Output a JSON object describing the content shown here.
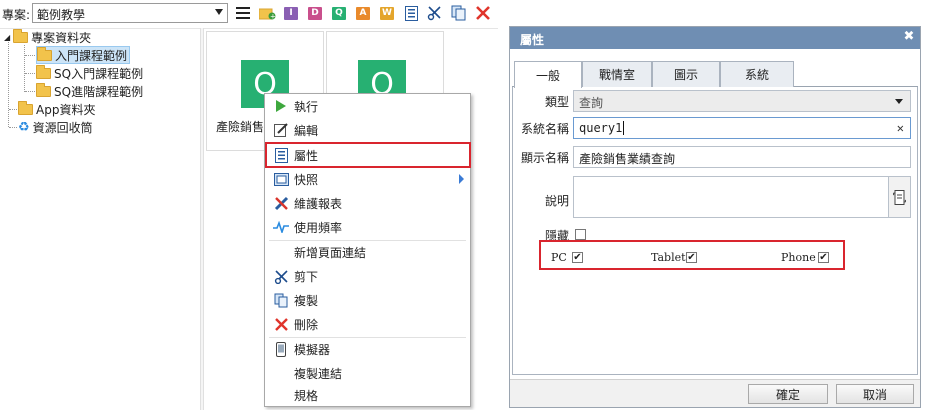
{
  "toolbar": {
    "project_label": "專案:",
    "project_value": "範例教學",
    "icon_letters": {
      "i": "I",
      "d": "D",
      "q": "Q",
      "a": "A",
      "w": "W"
    }
  },
  "tree": {
    "root": "專案資料夾",
    "children": [
      "入門課程範例",
      "SQ入門課程範例",
      "SQ進階課程範例"
    ],
    "app_folder": "App資料夾",
    "recycle": "資源回收筒"
  },
  "content": {
    "tile1_label": "產險銷售",
    "q_letter": "Q"
  },
  "context_menu": {
    "items": [
      "執行",
      "編輯",
      "屬性",
      "快照",
      "維護報表",
      "使用頻率",
      "新增頁面連結",
      "剪下",
      "複製",
      "刪除",
      "模擬器",
      "複製連結",
      "規格"
    ]
  },
  "dialog": {
    "title": "屬性",
    "tabs": [
      "一般",
      "戰情室",
      "圖示",
      "系統"
    ],
    "labels": {
      "type": "類型",
      "system_name": "系統名稱",
      "display_name": "顯示名稱",
      "description": "說明",
      "hidden": "隱藏"
    },
    "values": {
      "type": "查詢",
      "system_name": "query1",
      "display_name": "產險銷售業績查詢",
      "description": ""
    },
    "devices": [
      "PC",
      "Tablet",
      "Phone"
    ],
    "buttons": {
      "ok": "確定",
      "cancel": "取消"
    }
  },
  "colors": {
    "accent_red": "#d9252e",
    "dialog_title_bg": "#6f8eb3",
    "q_green": "#27b072"
  }
}
